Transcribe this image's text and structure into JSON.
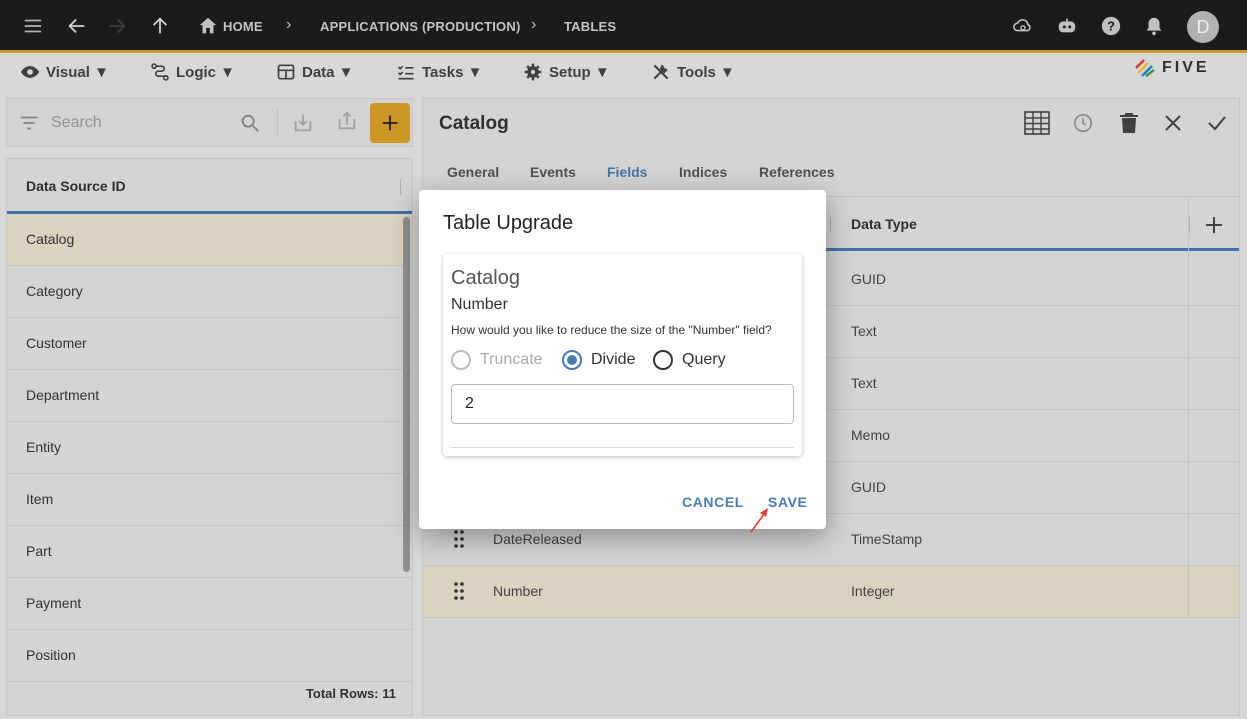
{
  "topbar": {
    "breadcrumbs": [
      "HOME",
      "APPLICATIONS (PRODUCTION)",
      "TABLES"
    ],
    "avatar": "D"
  },
  "menubar": {
    "items": [
      "Visual ▼",
      "Logic ▼",
      "Data ▼",
      "Tasks ▼",
      "Setup ▼",
      "Tools ▼"
    ],
    "logo": "FIVE"
  },
  "left": {
    "search_placeholder": "Search",
    "column_header": "Data Source ID",
    "items": [
      "Catalog",
      "Category",
      "Customer",
      "Department",
      "Entity",
      "Item",
      "Part",
      "Payment",
      "Position"
    ],
    "total_rows": "Total Rows: 11"
  },
  "right": {
    "title": "Catalog",
    "tabs": [
      "General",
      "Events",
      "Fields",
      "Indices",
      "References"
    ],
    "active_tab": "Fields",
    "column_header": "Data Type",
    "rows": [
      {
        "field": "",
        "type": "GUID"
      },
      {
        "field": "",
        "type": "Text"
      },
      {
        "field": "",
        "type": "Text"
      },
      {
        "field": "",
        "type": "Memo"
      },
      {
        "field": "",
        "type": "GUID"
      },
      {
        "field": "DateReleased",
        "type": "TimeStamp"
      },
      {
        "field": "Number",
        "type": "Integer"
      }
    ]
  },
  "dialog": {
    "title": "Table Upgrade",
    "card_title": "Catalog",
    "field_name": "Number",
    "question": "How would you like to reduce the size of the \"Number\" field?",
    "options": [
      "Truncate",
      "Divide",
      "Query"
    ],
    "selected_option": "Divide",
    "value": "2",
    "cancel_label": "CANCEL",
    "save_label": "SAVE"
  },
  "colors": {
    "accent": "#4a7ab3",
    "brand": "#d9a12a",
    "topbar": "#1d1d1d",
    "selected_row": "#e8e1cc"
  }
}
